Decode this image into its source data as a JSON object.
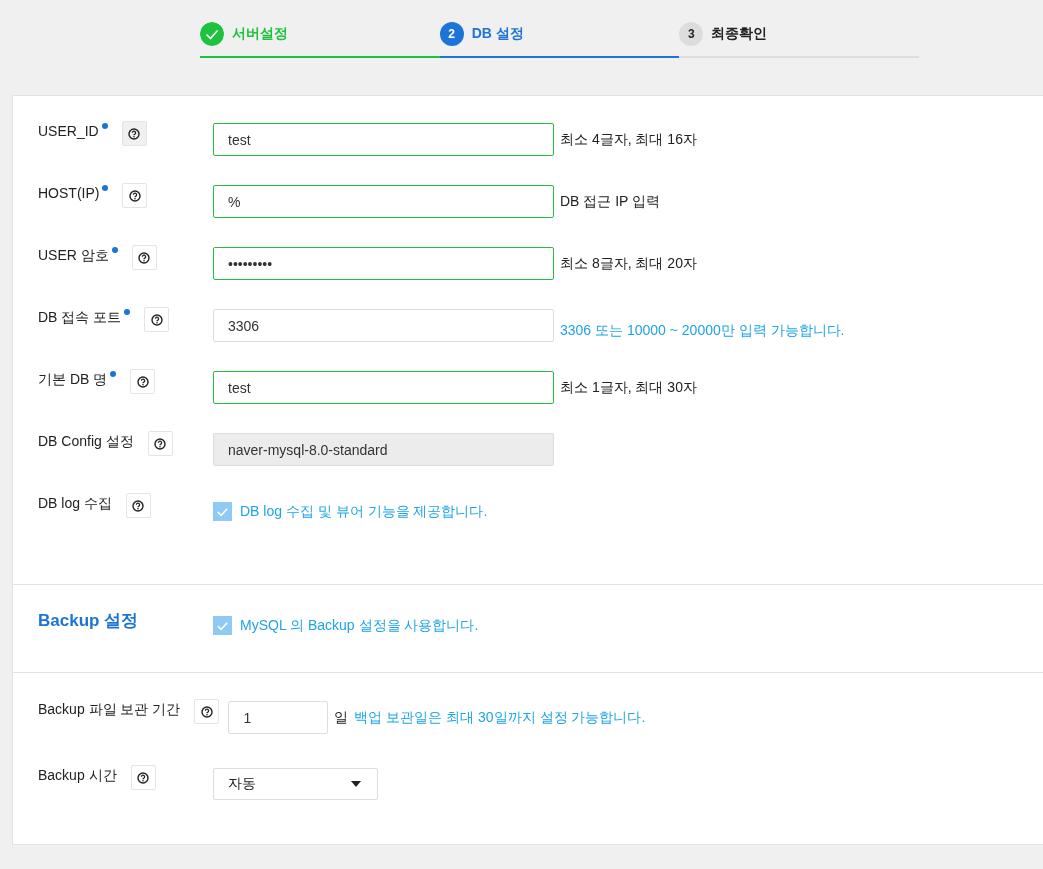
{
  "steps": [
    {
      "label": "서버설정",
      "completed": true,
      "selected": false
    },
    {
      "number": "2",
      "label": "DB 설정",
      "completed": false,
      "selected": true
    },
    {
      "number": "3",
      "label": "최종확인",
      "completed": false,
      "selected": false
    }
  ],
  "fields": [
    {
      "label": "USER_ID",
      "required": true,
      "kind": "text",
      "value": "test",
      "valid": true,
      "hint": "최소 4글자, 최대 16자",
      "hint_highlighted": false
    },
    {
      "label": "HOST(IP)",
      "required": true,
      "kind": "text",
      "value": "%",
      "valid": true,
      "hint": "DB 접근 IP 입력",
      "hint_highlighted": false
    },
    {
      "label": "USER 암호",
      "required": true,
      "kind": "text",
      "value": "•••••••••",
      "valid": true,
      "hint": "최소 8글자, 최대 20자",
      "hint_highlighted": false
    },
    {
      "label": "DB 접속 포트",
      "required": true,
      "kind": "text",
      "value": "3306",
      "valid": false,
      "hint": "3306 또는 10000 ~ 20000만 입력 가능합니다.",
      "hint_highlighted": true
    },
    {
      "label": "기본 DB 명",
      "required": true,
      "kind": "text",
      "value": "test",
      "valid": true,
      "hint": "최소 1글자, 최대 30자",
      "hint_highlighted": false
    },
    {
      "label": "DB Config 설정",
      "required": false,
      "kind": "readonly",
      "value": "naver-mysql-8.0-standard"
    },
    {
      "label": "DB log 수집",
      "required": false,
      "kind": "checkbox",
      "checked": true,
      "text": "DB log 수집 및 뷰어 기능을 제공합니다."
    }
  ],
  "backup": {
    "title": "Backup 설정",
    "checked": true,
    "text": "MySQL 의 Backup 설정을 사용합니다."
  },
  "retention": {
    "label": "Backup 파일 보관 기간",
    "value": "1",
    "unit": "일",
    "hint": "백업 보관일은 최대 30일까지 설정 가능합니다."
  },
  "backup_time": {
    "label": "Backup 시간",
    "value": "자동"
  }
}
